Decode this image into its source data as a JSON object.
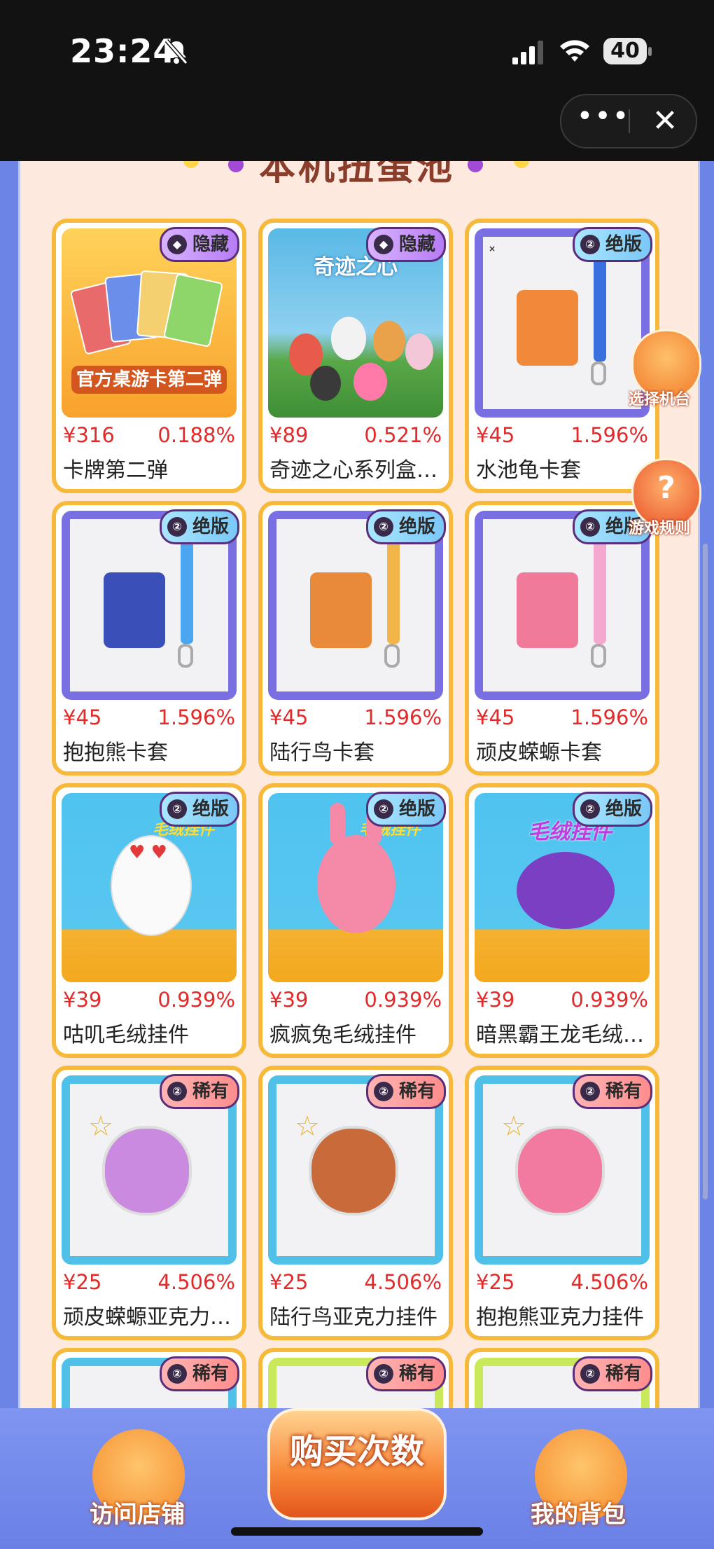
{
  "status_bar": {
    "time": "23:24",
    "battery": "40",
    "more_label": "•••",
    "close_label": "✕"
  },
  "section": {
    "title": "本机扭蛋池"
  },
  "items": [
    {
      "price": "¥316",
      "prob": "0.188%",
      "name": "卡牌第二弹",
      "badge": "隐藏",
      "art_title": "官方桌游卡第二弹"
    },
    {
      "price": "¥89",
      "prob": "0.521%",
      "name": "奇迹之心系列盒…",
      "badge": "隐藏",
      "art_title": "奇迹之心"
    },
    {
      "price": "¥45",
      "prob": "1.596%",
      "name": "水池龟卡套",
      "badge": "绝版"
    },
    {
      "price": "¥45",
      "prob": "1.596%",
      "name": "抱抱熊卡套",
      "badge": "绝版"
    },
    {
      "price": "¥45",
      "prob": "1.596%",
      "name": "陆行鸟卡套",
      "badge": "绝版"
    },
    {
      "price": "¥45",
      "prob": "1.596%",
      "name": "顽皮蝾螈卡套",
      "badge": "绝版"
    },
    {
      "price": "¥39",
      "prob": "0.939%",
      "name": "咕叽毛绒挂件",
      "badge": "绝版",
      "art_title": "毛绒挂件"
    },
    {
      "price": "¥39",
      "prob": "0.939%",
      "name": "疯疯兔毛绒挂件",
      "badge": "绝版",
      "art_title": "毛绒挂件"
    },
    {
      "price": "¥39",
      "prob": "0.939%",
      "name": "暗黑霸王龙毛绒…",
      "badge": "绝版",
      "art_title": "毛绒挂件"
    },
    {
      "price": "¥25",
      "prob": "4.506%",
      "name": "顽皮蝾螈亚克力…",
      "badge": "稀有"
    },
    {
      "price": "¥25",
      "prob": "4.506%",
      "name": "陆行鸟亚克力挂件",
      "badge": "稀有"
    },
    {
      "price": "¥25",
      "prob": "4.506%",
      "name": "抱抱熊亚克力挂件",
      "badge": "稀有"
    },
    {
      "badge": "稀有"
    },
    {
      "badge": "稀有"
    },
    {
      "badge": "稀有"
    }
  ],
  "side_buttons": {
    "select_machine": "选择机台",
    "game_rules": "游戏规则"
  },
  "bottom_nav": {
    "visit_store": "访问店铺",
    "buy_count": "购买次数",
    "my_bag": "我的背包"
  },
  "colors": {
    "badge_hidden": "#b77cf5",
    "badge_limited": "#7ac7f7",
    "badge_rare": "#ff8d8d",
    "price": "#e22a2a",
    "card_border": "#f6b93a"
  }
}
